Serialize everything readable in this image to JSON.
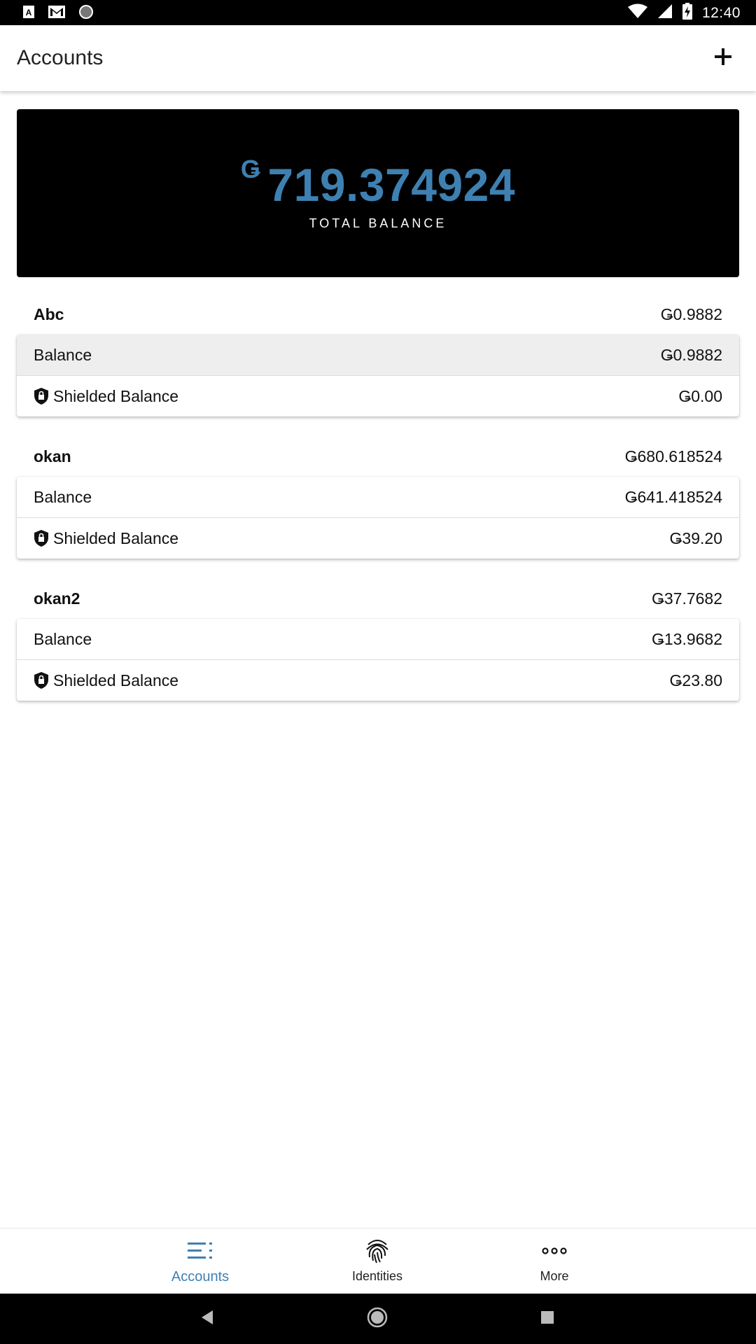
{
  "status_bar": {
    "time": "12:40",
    "icons_left": [
      "text-a-icon",
      "gmail-icon",
      "circle-icon"
    ],
    "icons_right": [
      "wifi-icon",
      "cell-signal-icon",
      "battery-charging-icon"
    ]
  },
  "app_bar": {
    "title": "Accounts",
    "add_icon": "plus-icon"
  },
  "total": {
    "currency_symbol": "Ǥ",
    "amount": "719.374924",
    "label": "TOTAL BALANCE"
  },
  "accounts": [
    {
      "name": "Abc",
      "total": "Ǥ0.9882",
      "rows": [
        {
          "label": "Balance",
          "value": "Ǥ0.9882"
        },
        {
          "label": "Shielded Balance",
          "value": "Ǥ0.00"
        }
      ]
    },
    {
      "name": "okan",
      "total": "Ǥ680.618524",
      "rows": [
        {
          "label": "Balance",
          "value": "Ǥ641.418524"
        },
        {
          "label": "Shielded Balance",
          "value": "Ǥ39.20"
        }
      ]
    },
    {
      "name": "okan2",
      "total": "Ǥ37.7682",
      "rows": [
        {
          "label": "Balance",
          "value": "Ǥ13.9682"
        },
        {
          "label": "Shielded Balance",
          "value": "Ǥ23.80"
        }
      ]
    }
  ],
  "bottom_nav": {
    "items": [
      {
        "label": "Accounts",
        "icon": "list-icon",
        "active": true
      },
      {
        "label": "Identities",
        "icon": "fingerprint-icon",
        "active": false
      },
      {
        "label": "More",
        "icon": "more-dots-icon",
        "active": false
      }
    ]
  },
  "colors": {
    "accent": "#3e80b1",
    "card_bg": "#000000",
    "highlight_row": "#eeeeee"
  }
}
